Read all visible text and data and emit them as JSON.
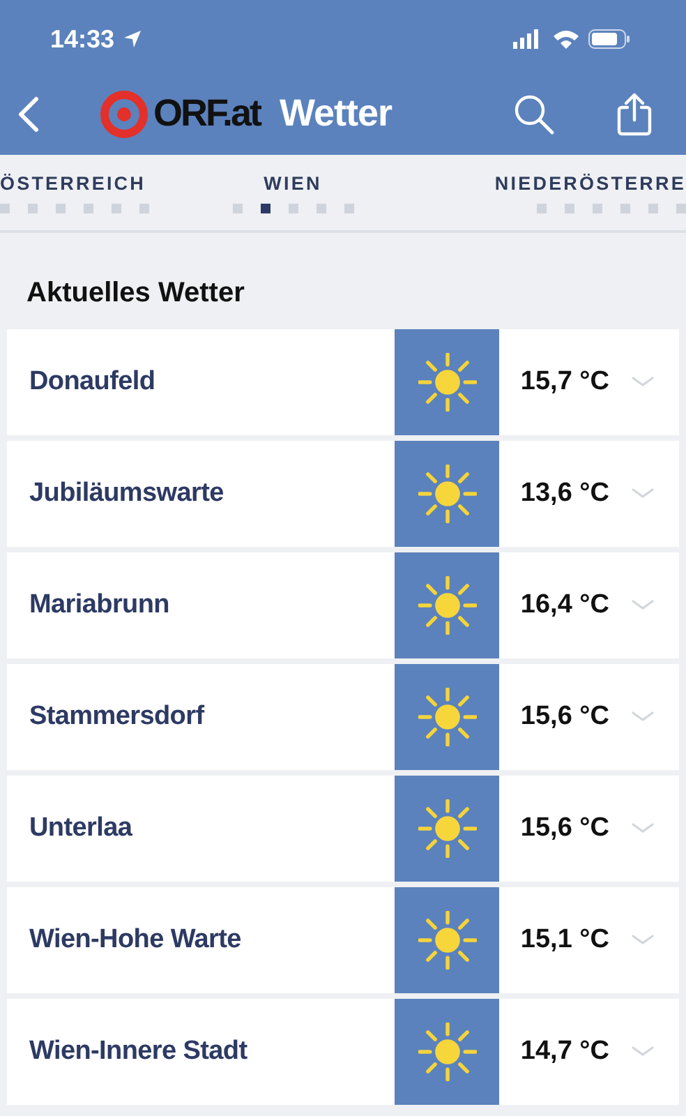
{
  "status_bar": {
    "time": "14:33"
  },
  "nav_bar": {
    "logo_text": "ORF.at",
    "title": "Wetter"
  },
  "tabs": [
    {
      "label": "ÖSTERREICH",
      "dots": [
        {
          "selected": false
        },
        {
          "selected": false
        },
        {
          "selected": false
        },
        {
          "selected": false
        },
        {
          "selected": false
        },
        {
          "selected": false
        }
      ]
    },
    {
      "label": "WIEN",
      "dots": [
        {
          "selected": false
        },
        {
          "selected": true
        },
        {
          "selected": false
        },
        {
          "selected": false
        },
        {
          "selected": false
        }
      ]
    },
    {
      "label": "NIEDERÖSTERRE",
      "dots": [
        {
          "selected": false
        },
        {
          "selected": false
        },
        {
          "selected": false
        },
        {
          "selected": false
        },
        {
          "selected": false
        },
        {
          "selected": false
        }
      ]
    }
  ],
  "section_title": "Aktuelles Wetter",
  "stations": [
    {
      "name": "Donaufeld",
      "temperature": "15,7 °C"
    },
    {
      "name": "Jubiläumswarte",
      "temperature": "13,6 °C"
    },
    {
      "name": "Mariabrunn",
      "temperature": "16,4 °C"
    },
    {
      "name": "Stammersdorf",
      "temperature": "15,6 °C"
    },
    {
      "name": "Unterlaa",
      "temperature": "15,6 °C"
    },
    {
      "name": "Wien-Hohe Warte",
      "temperature": "15,1 °C"
    },
    {
      "name": "Wien-Innere Stadt",
      "temperature": "14,7 °C"
    }
  ]
}
